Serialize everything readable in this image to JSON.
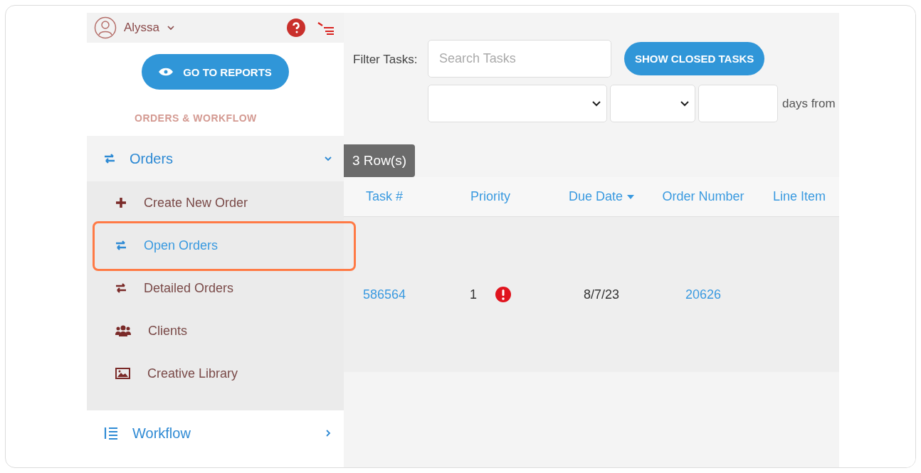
{
  "user": {
    "name": "Alyssa"
  },
  "reports_button": {
    "label": "GO TO REPORTS"
  },
  "section_heading": "ORDERS & WORKFLOW",
  "menu": [
    {
      "label": "Orders",
      "expanded": true,
      "children": [
        {
          "label": "Create New Order",
          "selected": false,
          "highlighted": false
        },
        {
          "label": "Open Orders",
          "selected": true,
          "highlighted": true
        },
        {
          "label": "Detailed Orders",
          "selected": false,
          "highlighted": false
        },
        {
          "label": "Clients",
          "selected": false,
          "highlighted": false
        },
        {
          "label": "Creative Library",
          "selected": false,
          "highlighted": false
        }
      ]
    },
    {
      "label": "Workflow",
      "expanded": false
    }
  ],
  "filter": {
    "label": "Filter Tasks:",
    "search_placeholder": "Search Tasks",
    "button": "SHOW CLOSED TASKS",
    "days_text": "days from"
  },
  "row_count": "3 Row(s)",
  "table": {
    "columns": [
      {
        "label": "Task #",
        "sorted": false
      },
      {
        "label": "Priority",
        "sorted": false
      },
      {
        "label": "Due Date",
        "sorted": true
      },
      {
        "label": "Order Number",
        "sorted": false
      },
      {
        "label": "Line Item",
        "sorted": false
      }
    ],
    "rows": [
      {
        "task": "586564",
        "priority": "1",
        "urgent": true,
        "due_date": "8/7/23",
        "order_number": "20626"
      }
    ]
  }
}
